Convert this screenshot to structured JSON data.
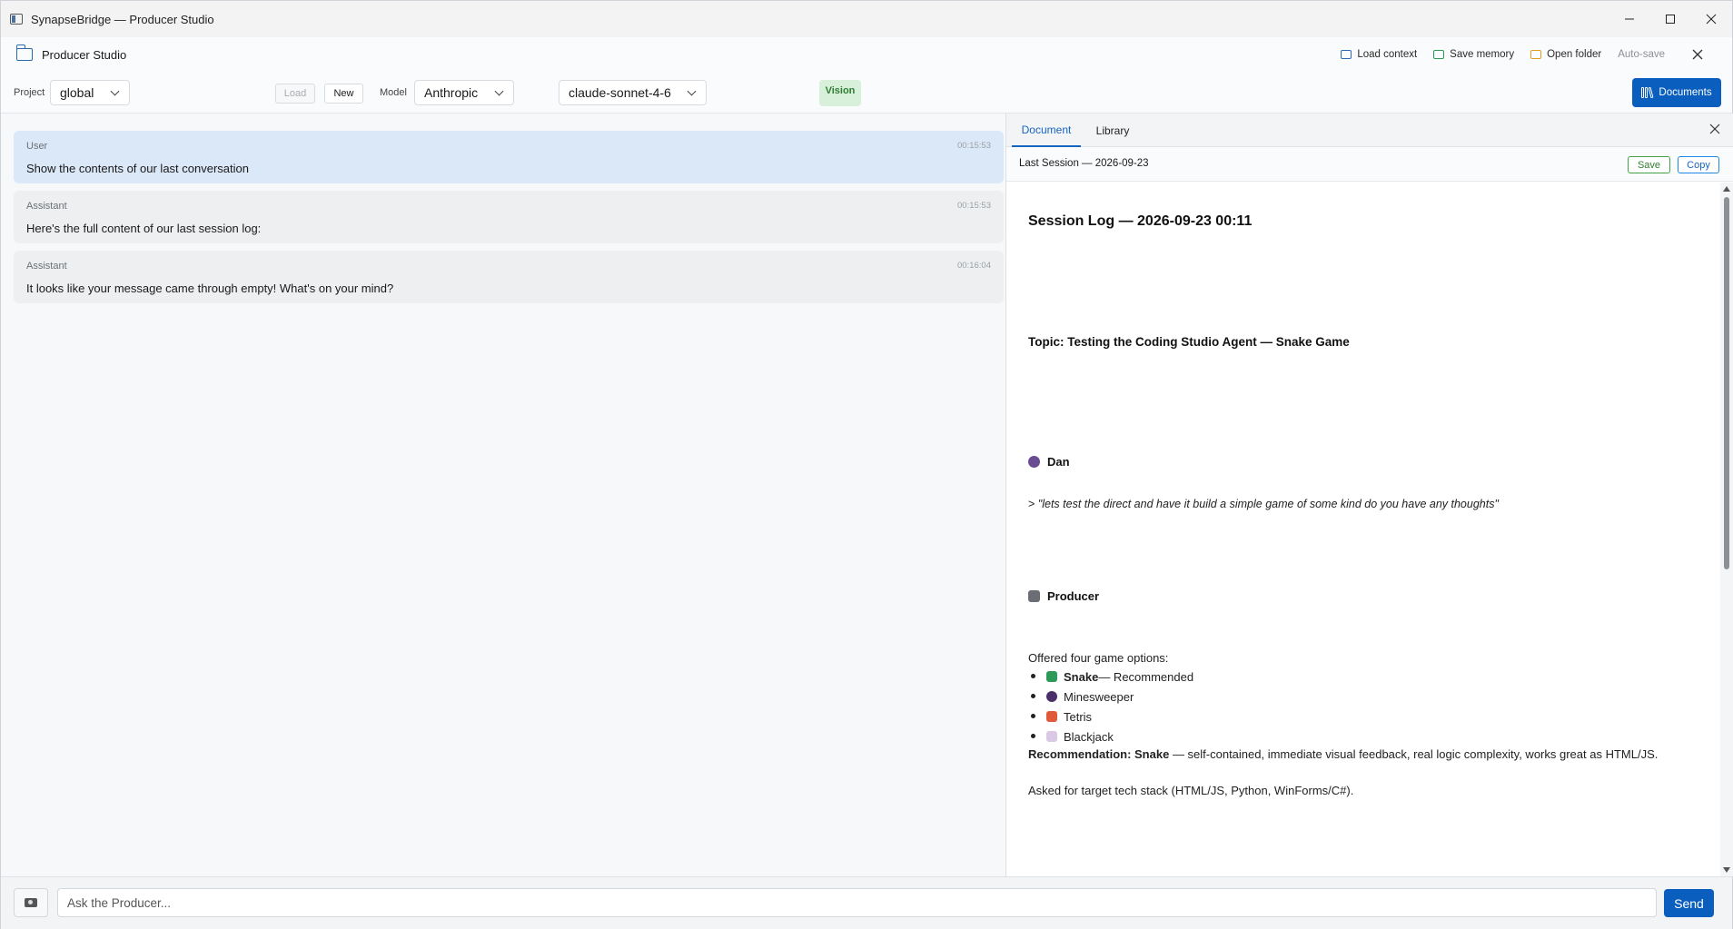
{
  "window": {
    "title": "SynapseBridge — Producer Studio"
  },
  "header": {
    "title": "Producer Studio",
    "actions": {
      "load_context": "Load context",
      "save_memory": "Save memory",
      "open_folder": "Open folder",
      "auto_save": "Auto-save"
    }
  },
  "toolbar": {
    "project_label": "Project",
    "project_value": "global",
    "load_label": "Load",
    "new_label": "New",
    "model_label": "Model",
    "provider_value": "Anthropic",
    "model_value": "claude-sonnet-4-6",
    "vision_badge": "Vision",
    "documents_label": "Documents"
  },
  "chat": {
    "messages": [
      {
        "role": "User",
        "time": "00:15:53",
        "text": "Show the contents of our last conversation"
      },
      {
        "role": "Assistant",
        "time": "00:15:53",
        "text": "Here's the full content of our last session log:"
      },
      {
        "role": "Assistant",
        "time": "00:16:04",
        "text": "It looks like your message came through empty! What's on your mind?"
      }
    ]
  },
  "document_panel": {
    "tabs": [
      "Document",
      "Library"
    ],
    "active_tab": "Document",
    "doc_title": "Last Session — 2026-09-23",
    "save_label": "Save",
    "copy_label": "Copy",
    "content": {
      "heading": "Session Log — 2026-09-23 00:11",
      "topic": "Topic: Testing the Coding Studio Agent — Snake Game",
      "speaker1": "Dan",
      "quote_prefix": ">",
      "quote": "\"lets test the direct and have it build a simple game of some kind do you have any thoughts\"",
      "speaker2": "Producer",
      "offered": "Offered four game options:",
      "options": [
        {
          "name": "Snake",
          "suffix": " — Recommended",
          "bold": true
        },
        {
          "name": "Minesweeper",
          "suffix": "",
          "bold": false
        },
        {
          "name": "Tetris",
          "suffix": "",
          "bold": false
        },
        {
          "name": "Blackjack",
          "suffix": "",
          "bold": false
        }
      ],
      "recommendation_label": "Recommendation: Snake",
      "recommendation_text": " — self-contained, immediate visual feedback, real logic complexity, works great as HTML/JS.",
      "asked": "Asked for target tech stack (HTML/JS, Python, WinForms/C#)."
    }
  },
  "input": {
    "placeholder": "Ask the Producer...",
    "send_label": "Send"
  },
  "colors": {
    "accent": "#0a5ebd",
    "user_bubble": "#dbe8f8",
    "assistant_bubble": "#eeeff1",
    "vision_bg": "#d8f0d9"
  }
}
